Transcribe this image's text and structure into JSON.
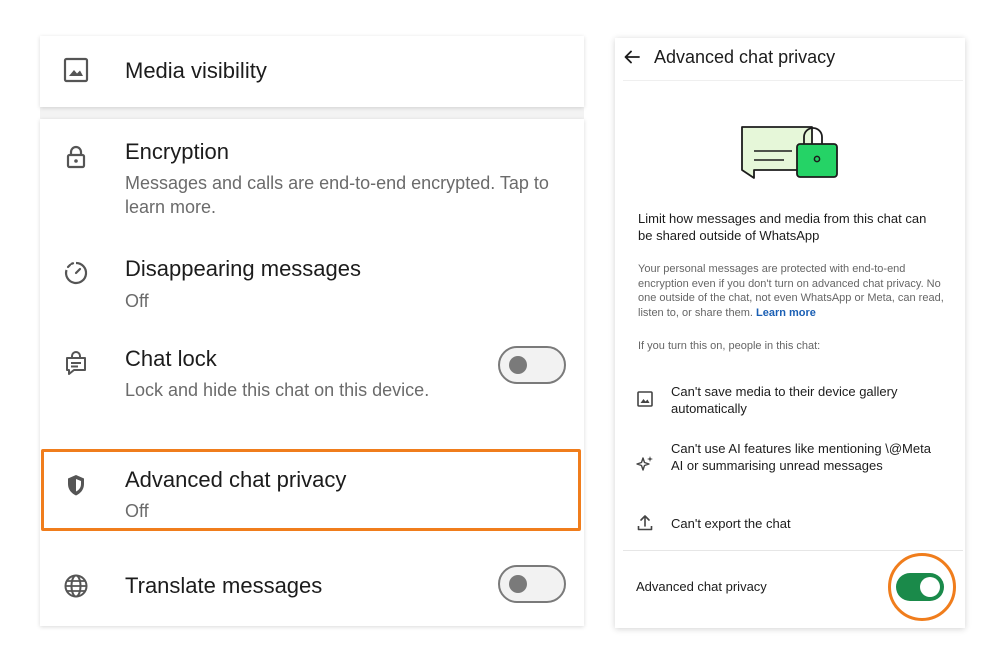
{
  "left": {
    "media_visibility": {
      "title": "Media visibility",
      "icon": "image-icon"
    },
    "encryption": {
      "title": "Encryption",
      "sub": "Messages and calls are end-to-end encrypted. Tap to learn more.",
      "icon": "lock-icon"
    },
    "disappearing": {
      "title": "Disappearing messages",
      "sub": "Off",
      "icon": "timer-icon"
    },
    "chat_lock": {
      "title": "Chat lock",
      "sub": "Lock and hide this chat on this device.",
      "toggle": "off",
      "icon": "chat-lock-icon"
    },
    "advanced_privacy": {
      "title": "Advanced chat privacy",
      "sub": "Off",
      "icon": "shield-icon"
    },
    "translate": {
      "title": "Translate messages",
      "toggle": "off",
      "icon": "globe-icon"
    }
  },
  "right": {
    "header_title": "Advanced chat privacy",
    "headline": "Limit how messages and media from this chat can be shared outside of WhatsApp",
    "body": "Your personal messages are protected with end-to-end encryption even if you don't turn on advanced chat privacy. No one outside of the chat, not even WhatsApp or Meta, can read, listen to, or share them.",
    "learn_more": "Learn more",
    "intro": "If you turn this on, people in this chat:",
    "permissions": [
      {
        "label": "Can't save media to their device gallery automatically",
        "icon": "image-icon"
      },
      {
        "label": "Can't use AI features like mentioning \\@Meta AI or summarising unread messages",
        "icon": "sparkle-icon"
      },
      {
        "label": "Can't export the chat",
        "icon": "upload-icon"
      }
    ],
    "toggle_label": "Advanced chat privacy",
    "toggle_state": "on"
  },
  "colors": {
    "accent_orange": "#f07d1c",
    "whatsapp_green": "#1a8a4a",
    "illustration_green": "#25d366"
  }
}
